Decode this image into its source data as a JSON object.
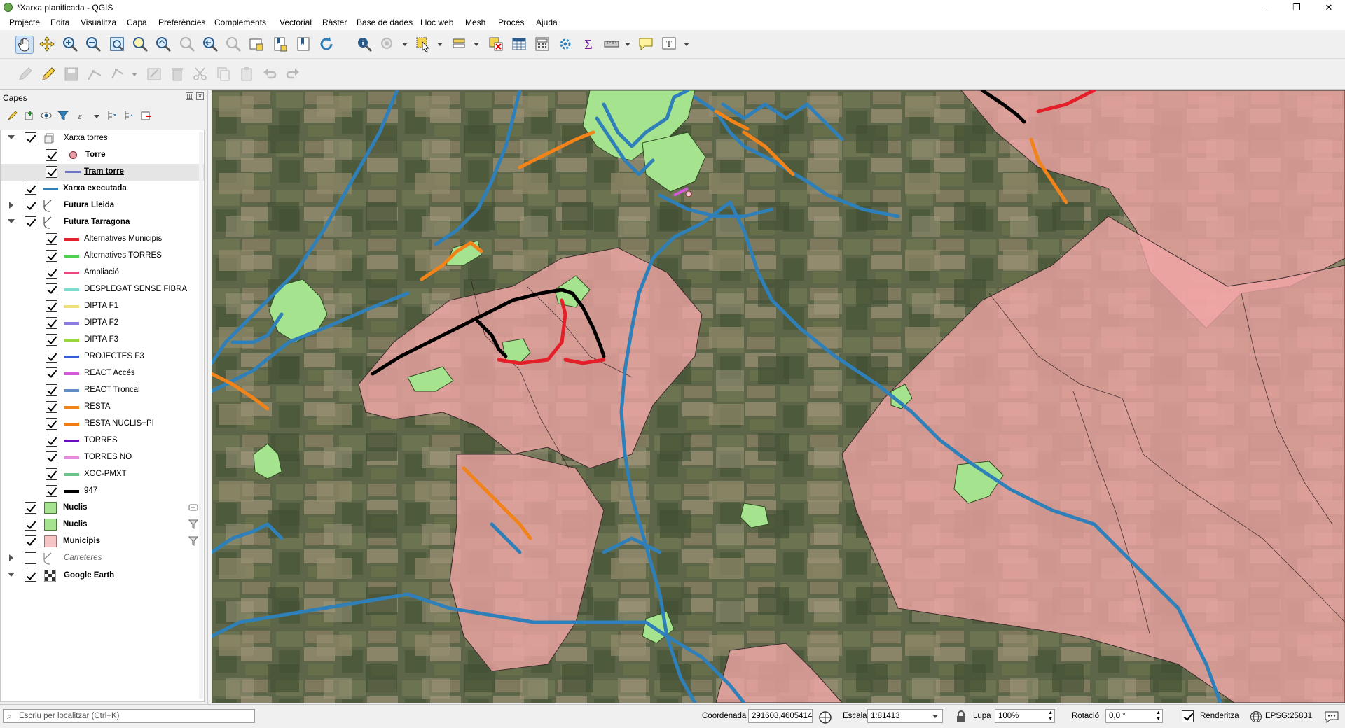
{
  "window": {
    "title": "*Xarxa planificada - QGIS",
    "controls": [
      "–",
      "❐",
      "✕"
    ]
  },
  "menu": [
    "Projecte",
    "Edita",
    "Visualitza",
    "Capa",
    "Preferències",
    "Complements",
    "Vectorial",
    "Ràster",
    "Base de dades",
    "Lloc web",
    "Mesh",
    "Procés",
    "Ajuda"
  ],
  "toolbar_main": {
    "icons": [
      "pan-map-icon",
      "pan-to-selection-icon",
      "zoom-in-icon",
      "zoom-out-icon",
      "zoom-full-icon",
      "zoom-to-selection-icon",
      "zoom-to-layer-icon",
      "zoom-native-icon",
      "zoom-last-icon",
      "zoom-next-icon",
      "new-map-view-icon",
      "new-bookmark-icon",
      "show-bookmarks-icon",
      "refresh-icon",
      "identify-icon",
      "action-icon",
      "select-features-icon",
      "attribute-select-icon",
      "deselect-icon",
      "attribute-table-icon",
      "field-calculator-icon",
      "processing-toolbox-icon",
      "statistics-icon",
      "measure-icon",
      "map-tips-icon",
      "text-annotation-icon"
    ]
  },
  "toolbar_digitize": {
    "icons": [
      "current-edits-icon",
      "toggle-editing-icon",
      "save-edits-icon",
      "digitize-icon",
      "vertex-tool-icon",
      "modify-attributes-icon",
      "delete-selected-icon",
      "cut-features-icon",
      "copy-features-icon",
      "paste-features-icon",
      "undo-icon",
      "redo-icon"
    ]
  },
  "layers_panel": {
    "title": "Capes",
    "layers": [
      {
        "label": "Xarxa torres",
        "style": "group",
        "depth": 0,
        "expanded": true,
        "checked": true,
        "symbol": "group",
        "color": ""
      },
      {
        "label": "Torre",
        "style": "bold",
        "depth": 1,
        "checked": true,
        "symbol": "point",
        "color": "#e8a0a8"
      },
      {
        "label": "Tram torre",
        "style": "bold-underline",
        "depth": 1,
        "checked": true,
        "symbol": "line",
        "color": "#6b74c9",
        "selected": true
      },
      {
        "label": "Xarxa executada",
        "style": "bold",
        "depth": 0,
        "checked": true,
        "symbol": "line",
        "color": "#2f7fb8"
      },
      {
        "label": "Futura Lleida",
        "style": "group",
        "depth": 0,
        "expanded": false,
        "checked": true,
        "symbol": "rule",
        "color": ""
      },
      {
        "label": "Futura Tarragona",
        "style": "group",
        "depth": 0,
        "expanded": true,
        "checked": true,
        "symbol": "rule",
        "color": ""
      },
      {
        "label": "Alternatives Municipis",
        "style": "normal",
        "depth": 1,
        "checked": true,
        "symbol": "line",
        "color": "#e3202a"
      },
      {
        "label": "Alternatives TORRES",
        "style": "normal",
        "depth": 1,
        "checked": true,
        "symbol": "line",
        "color": "#4fd04f"
      },
      {
        "label": "Ampliació",
        "style": "normal",
        "depth": 1,
        "checked": true,
        "symbol": "line",
        "color": "#e8477f"
      },
      {
        "label": "DESPLEGAT SENSE FIBRA",
        "style": "normal",
        "depth": 1,
        "checked": true,
        "symbol": "line",
        "color": "#7ddbd0"
      },
      {
        "label": "DIPTA F1",
        "style": "normal",
        "depth": 1,
        "checked": true,
        "symbol": "line",
        "color": "#eee07a"
      },
      {
        "label": "DIPTA F2",
        "style": "normal",
        "depth": 1,
        "checked": true,
        "symbol": "line",
        "color": "#8a7be0"
      },
      {
        "label": "DIPTA F3",
        "style": "normal",
        "depth": 1,
        "checked": true,
        "symbol": "line",
        "color": "#9bd53d"
      },
      {
        "label": "PROJECTES F3",
        "style": "normal",
        "depth": 1,
        "checked": true,
        "symbol": "line",
        "color": "#3a5bd6"
      },
      {
        "label": "REACT Accés",
        "style": "normal",
        "depth": 1,
        "checked": true,
        "symbol": "line",
        "color": "#d35ad8"
      },
      {
        "label": "REACT Troncal",
        "style": "normal",
        "depth": 1,
        "checked": true,
        "symbol": "line",
        "color": "#5f8fc4"
      },
      {
        "label": "RESTA",
        "style": "normal",
        "depth": 1,
        "checked": true,
        "symbol": "line",
        "color": "#f0831a"
      },
      {
        "label": "RESTA NUCLIS+PI",
        "style": "normal",
        "depth": 1,
        "checked": true,
        "symbol": "line",
        "color": "#f07b12"
      },
      {
        "label": "TORRES",
        "style": "normal",
        "depth": 1,
        "checked": true,
        "symbol": "line",
        "color": "#6a0dbf"
      },
      {
        "label": "TORRES NO",
        "style": "normal",
        "depth": 1,
        "checked": true,
        "symbol": "line",
        "color": "#e58be0"
      },
      {
        "label": "XOC-PMXT",
        "style": "normal",
        "depth": 1,
        "checked": true,
        "symbol": "line",
        "color": "#6cc48a"
      },
      {
        "label": "947",
        "style": "normal",
        "depth": 1,
        "checked": true,
        "symbol": "line",
        "color": "#000000"
      },
      {
        "label": "Nuclis",
        "style": "bold",
        "depth": 0,
        "checked": true,
        "symbol": "fill",
        "color": "#a6e38f",
        "right_icon": "embedded-layer-icon"
      },
      {
        "label": "Nuclis",
        "style": "bold",
        "depth": 0,
        "checked": true,
        "symbol": "fill",
        "color": "#a6e38f",
        "right_icon": "filter-icon"
      },
      {
        "label": "Municipis",
        "style": "bold",
        "depth": 0,
        "checked": true,
        "symbol": "fill",
        "color": "#f5c4c4",
        "right_icon": "filter-icon"
      },
      {
        "label": "Carreteres",
        "style": "italic",
        "depth": 0,
        "expanded": false,
        "checked": false,
        "symbol": "rule",
        "color": ""
      },
      {
        "label": "Google Earth",
        "style": "group-raster",
        "depth": 0,
        "expanded": true,
        "checked": true,
        "symbol": "raster",
        "color": ""
      }
    ]
  },
  "map_colors": {
    "background": "#5d6648",
    "executed_network": "#2f7fb8",
    "municipality_fill": "#f2a6a6",
    "nucleus_fill": "#a6e38f",
    "resta": "#f0831a",
    "alternatives": "#e3202a",
    "line_947": "#000000"
  },
  "status": {
    "locate_placeholder": "Escriu per localitzar (Ctrl+K)",
    "coordinate_label": "Coordenada",
    "coordinate_value": "291608,4605414",
    "scale_label": "Escala",
    "scale_value": "1:81413",
    "magnifier_label": "Lupa",
    "magnifier_value": "100%",
    "rotation_label": "Rotació",
    "rotation_value": "0,0 °",
    "render_label": "Renderitza",
    "render_checked": true,
    "crs": "EPSG:25831"
  }
}
